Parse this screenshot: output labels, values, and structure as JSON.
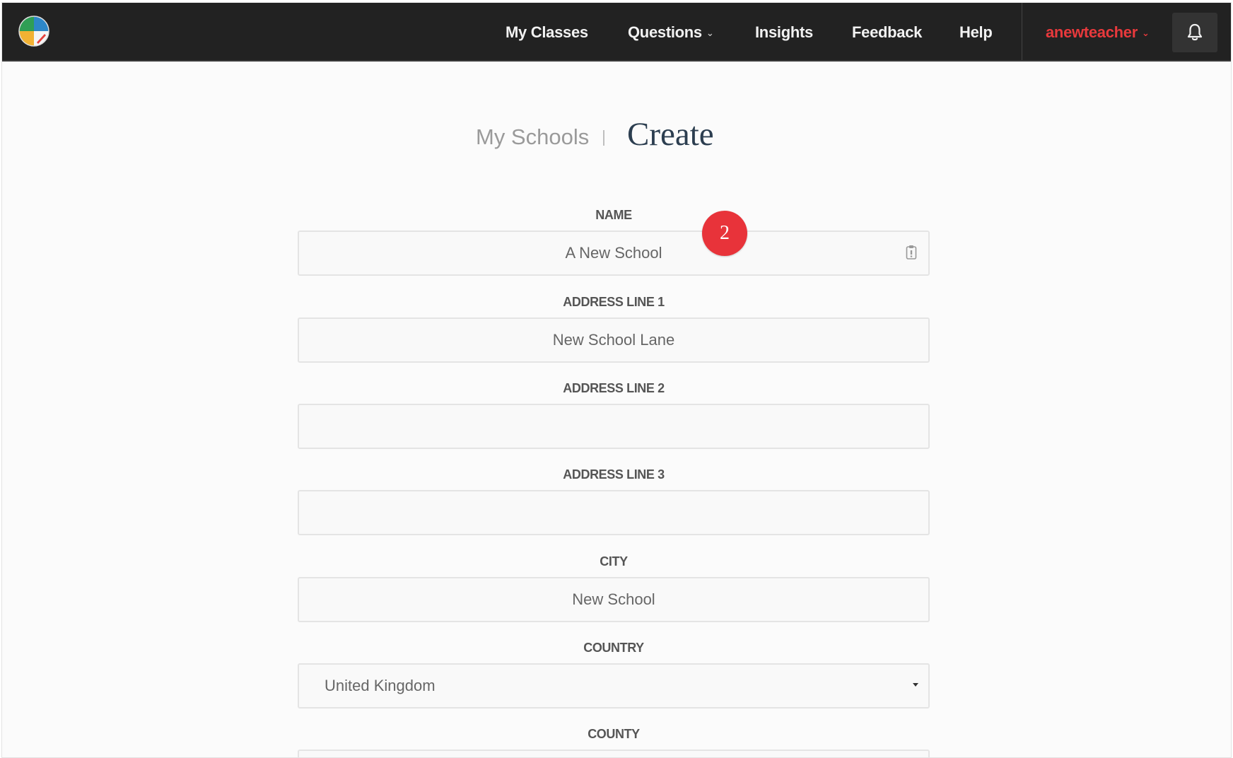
{
  "nav": {
    "items": [
      {
        "label": "My Classes"
      },
      {
        "label": "Questions",
        "caret": "⌄"
      },
      {
        "label": "Insights"
      },
      {
        "label": "Feedback"
      },
      {
        "label": "Help"
      }
    ],
    "user": {
      "label": "anewteacher",
      "caret": "⌄",
      "color": "#e8393c"
    },
    "bell_icon": "bell-icon",
    "logo_icon": "pie-logo-icon"
  },
  "heading": {
    "breadcrumb": "My Schools",
    "title": "Create"
  },
  "form": {
    "name": {
      "label": "NAME",
      "value": "A New School",
      "icon": "clipboard-icon"
    },
    "address1": {
      "label": "ADDRESS LINE 1",
      "value": "New School Lane"
    },
    "address2": {
      "label": "ADDRESS LINE 2",
      "value": ""
    },
    "address3": {
      "label": "ADDRESS LINE 3",
      "value": ""
    },
    "city": {
      "label": "CITY",
      "value": "New School"
    },
    "country": {
      "label": "COUNTRY",
      "value": "United Kingdom",
      "arrow": "▾"
    },
    "county": {
      "label": "COUNTY"
    }
  },
  "annotation": {
    "step": "2",
    "color": "#e8333a"
  },
  "colors": {
    "navbar_bg": "#222222",
    "title_text": "#2c3e50",
    "accent_red": "#e8393c"
  }
}
